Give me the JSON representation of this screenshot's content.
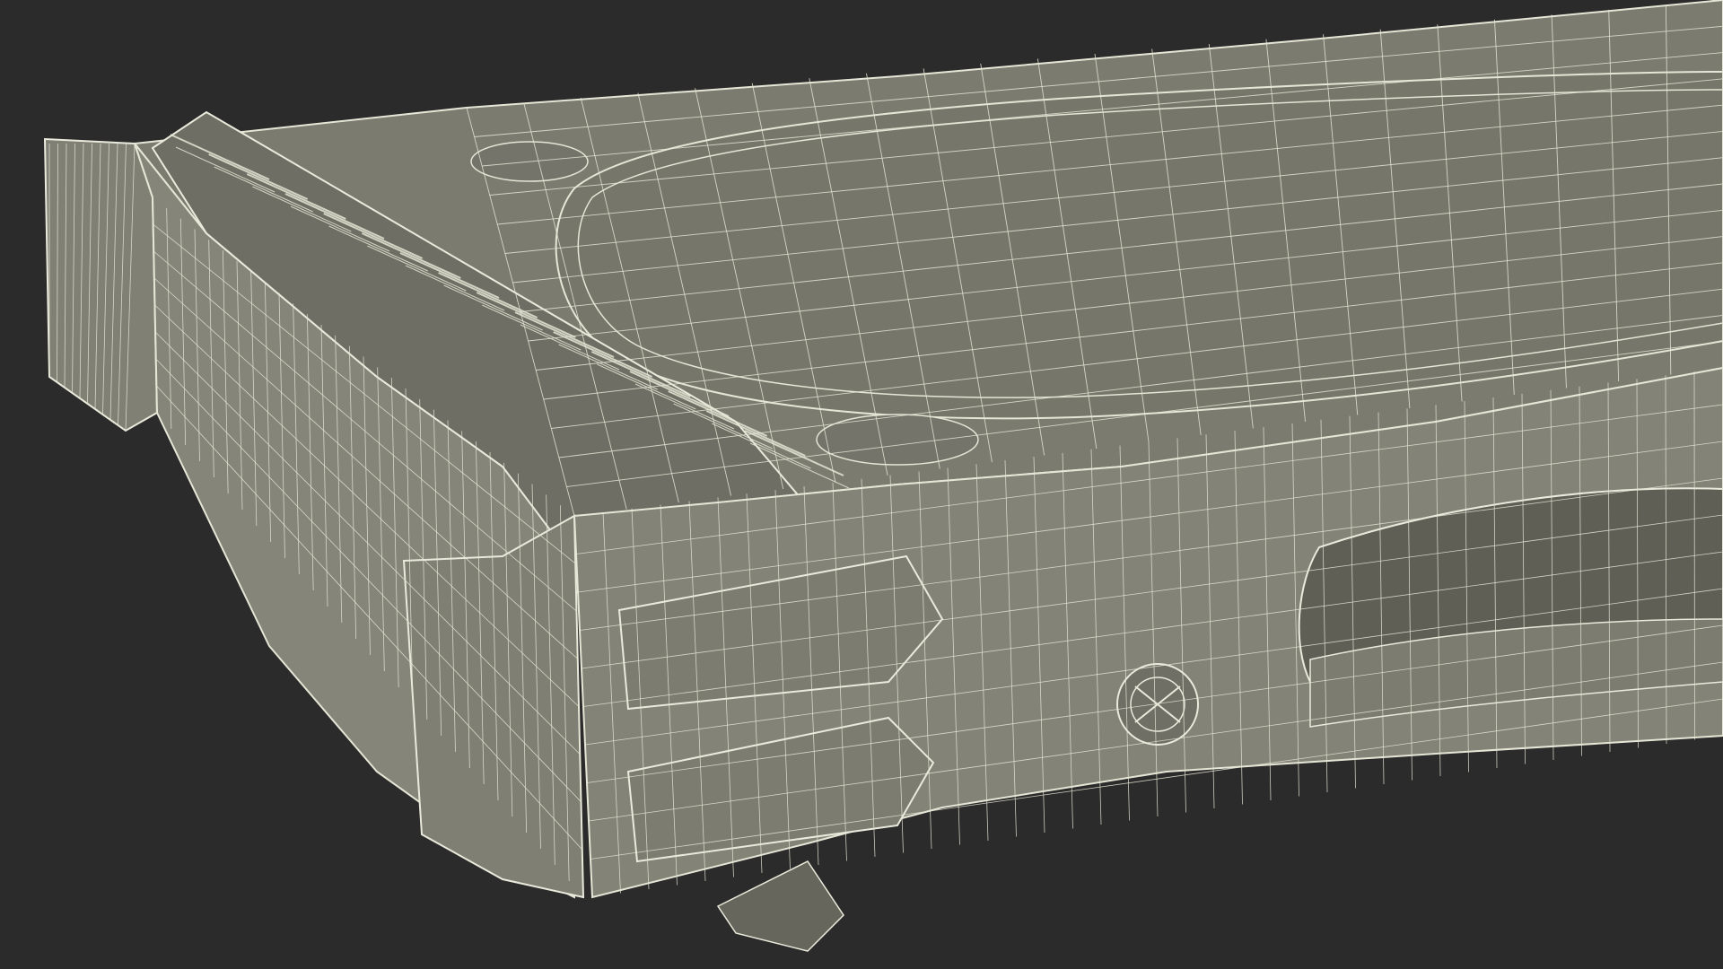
{
  "scene": {
    "subject": "",
    "colors": {
      "background": "#2b2b2b",
      "surface_top": "#7b7b70",
      "surface_side": "#85857a",
      "surface_dark": "#5e5e55",
      "wire": "#e6e6d6",
      "wire_dense": "#f1f1e4",
      "shadow": "#3a3a34"
    }
  }
}
